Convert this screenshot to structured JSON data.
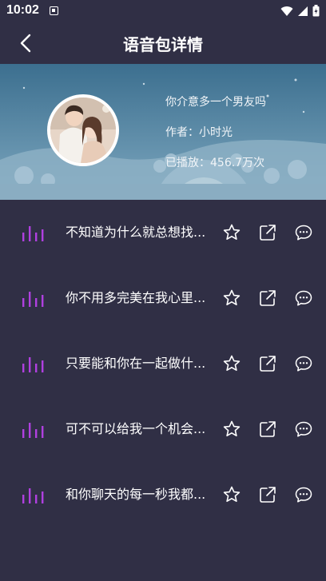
{
  "status_bar": {
    "time": "10:02"
  },
  "header": {
    "title": "语音包详情"
  },
  "pack": {
    "name": "你介意多一个男友吗",
    "author": "作者：小时光",
    "plays": "已播放：456.7万次"
  },
  "items": [
    {
      "title": "不知道为什么就总想找..."
    },
    {
      "title": "你不用多完美在我心里..."
    },
    {
      "title": "只要能和你在一起做什..."
    },
    {
      "title": "可不可以给我一个机会..."
    },
    {
      "title": "和你聊天的每一秒我都..."
    }
  ],
  "colors": {
    "background": "#302f45",
    "accent": "#b040e0"
  }
}
